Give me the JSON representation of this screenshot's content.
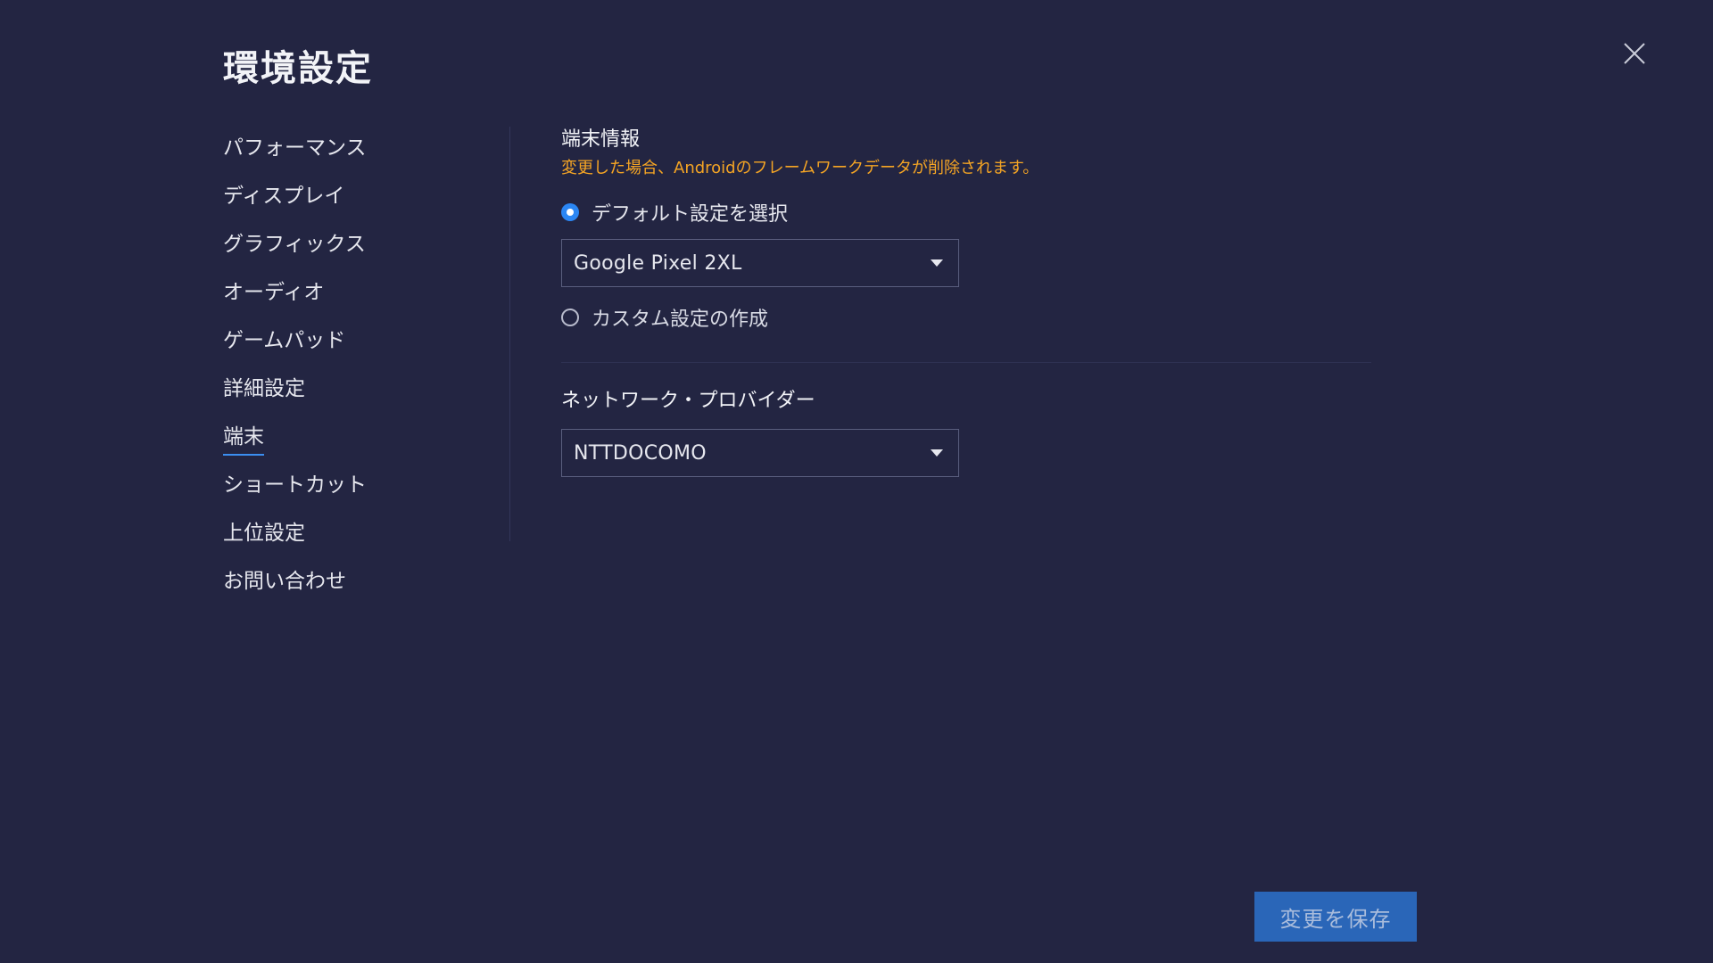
{
  "window": {
    "title": "環境設定"
  },
  "sidebar": {
    "items": [
      {
        "label": "パフォーマンス"
      },
      {
        "label": "ディスプレイ"
      },
      {
        "label": "グラフィックス"
      },
      {
        "label": "オーディオ"
      },
      {
        "label": "ゲームパッド"
      },
      {
        "label": "詳細設定"
      },
      {
        "label": "端末",
        "active": true
      },
      {
        "label": "ショートカット"
      },
      {
        "label": "上位設定"
      },
      {
        "label": "お問い合わせ"
      }
    ]
  },
  "device": {
    "title": "端末情報",
    "warning": "変更した場合、Androidのフレームワークデータが削除されます。",
    "default_option": {
      "label": "デフォルト設定を選択",
      "checked": true
    },
    "default_select": {
      "value": "Google Pixel 2XL"
    },
    "custom_option": {
      "label": "カスタム設定の作成",
      "checked": false
    }
  },
  "network": {
    "title": "ネットワーク・プロバイダー",
    "select": {
      "value": "NTTDOCOMO"
    }
  },
  "footer": {
    "save_label": "変更を保存"
  },
  "colors": {
    "background": "#232542",
    "accent": "#2b86f3",
    "warning": "#f5a524",
    "save_button": "#2a66b8"
  },
  "icons": {
    "close": "close-icon",
    "dropdown": "chevron-down-icon"
  }
}
